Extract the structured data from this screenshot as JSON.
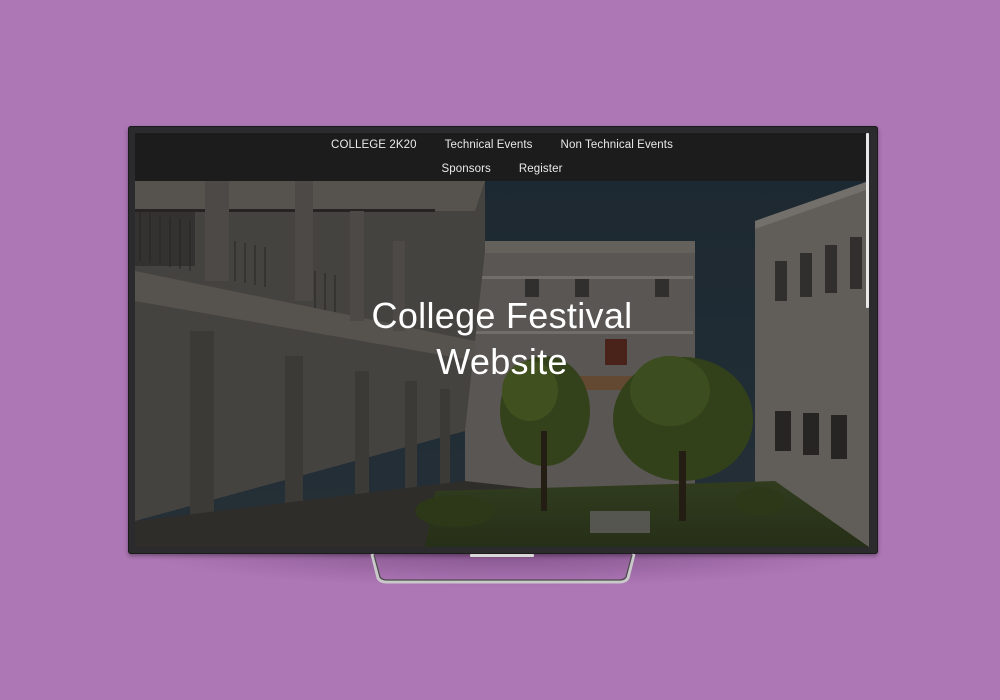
{
  "nav": {
    "brand": "COLLEGE 2K20",
    "links": [
      "Technical Events",
      "Non Technical Events",
      "Sponsors",
      "Register"
    ]
  },
  "hero": {
    "title_line1": "College Festival",
    "title_line2": "Website"
  },
  "colors": {
    "background": "#ad77b5",
    "navbar": "#1c1c1c",
    "tv_frame": "#2b2b2d"
  }
}
